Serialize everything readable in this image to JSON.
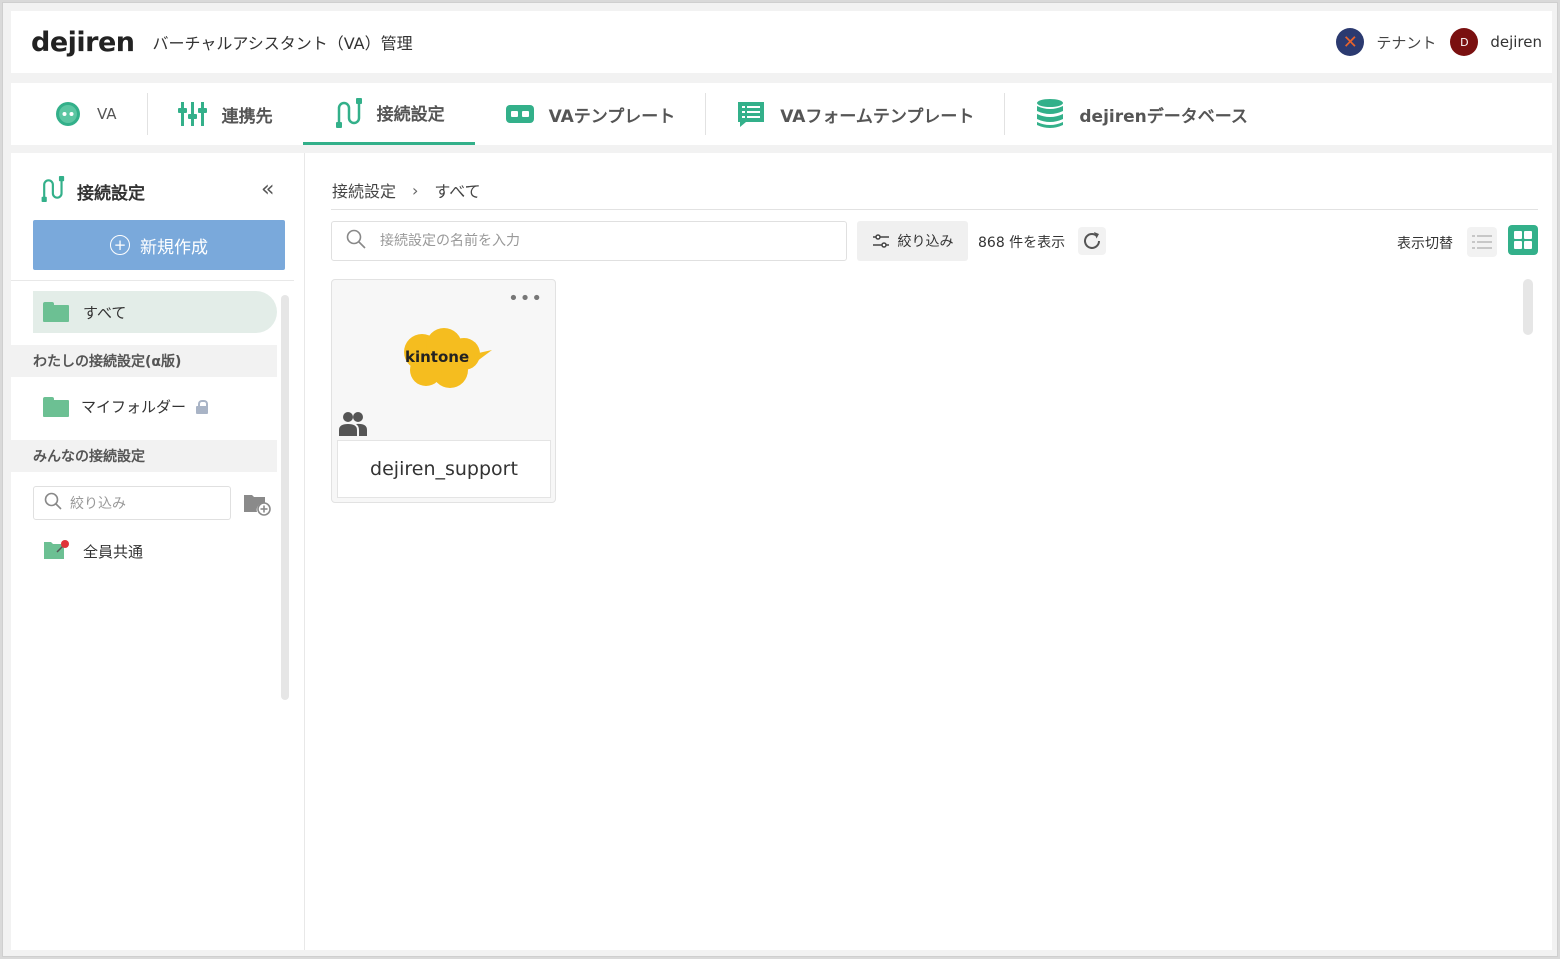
{
  "header": {
    "logo": "dejiren",
    "title": "バーチャルアシスタント（VA）管理",
    "tenant_label": "テナント",
    "user_initial": "D",
    "user_name": "dejiren"
  },
  "tabs": [
    {
      "label": "VA",
      "icon": "robot-face-icon",
      "active": false
    },
    {
      "label": "連携先",
      "icon": "connectors-icon",
      "active": false
    },
    {
      "label": "接続設定",
      "icon": "cable-icon",
      "active": true
    },
    {
      "label": "VAテンプレート",
      "icon": "template-icon",
      "active": false
    },
    {
      "label": "VAフォームテンプレート",
      "icon": "form-template-icon",
      "active": false
    },
    {
      "label": "dejirenデータベース",
      "icon": "database-icon",
      "active": false
    }
  ],
  "sidebar": {
    "title": "接続設定",
    "new_button": "新規作成",
    "all_label": "すべて",
    "my_section": "わたしの接続設定(α版)",
    "my_folder": "マイフォルダー",
    "shared_section": "みんなの接続設定",
    "filter_placeholder": "絞り込み",
    "shared_item": "全員共通"
  },
  "content": {
    "breadcrumb": [
      "接続設定",
      "すべて"
    ],
    "breadcrumb_sep": "›",
    "search_placeholder": "接続設定の名前を入力",
    "filter_button": "絞り込み",
    "count_text": "868 件を表示",
    "view_toggle_label": "表示切替",
    "cards": [
      {
        "service": "kintone",
        "name": "dejiren_support"
      }
    ]
  },
  "colors": {
    "accent": "#33b08a",
    "primary_button": "#7aa9db",
    "folder": "#6cc093",
    "kintone_yellow": "#f5bd1f"
  }
}
